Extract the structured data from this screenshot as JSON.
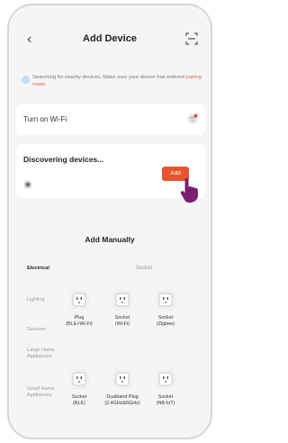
{
  "header": {
    "title": "Add Device",
    "back_icon": "chevron-left-icon",
    "scan_icon": "scan-icon"
  },
  "notice": {
    "text": "Searching for nearby devices. Make sure your device has entered ",
    "link": "pairing mode",
    "suffix": "."
  },
  "wifi": {
    "label": "Turn on Wi-Fi",
    "icon": "wifi-icon"
  },
  "discovering": {
    "label": "Discovering devices...",
    "add_button": "Add",
    "device_icon": "device-icon",
    "accent": "#e8542d"
  },
  "manual": {
    "title": "Add Manually",
    "categories": [
      {
        "label": "Electrical",
        "active": true
      },
      {
        "label": "Lighting",
        "active": false
      },
      {
        "label": "Sensors",
        "active": false
      },
      {
        "label": "Large Home Appliances",
        "active": false
      },
      {
        "label": "Small Home Appliances",
        "active": false
      }
    ],
    "section": "Socket",
    "devices": [
      {
        "label": "Plug\n(BLE+Wi-Fi)"
      },
      {
        "label": "Socket\n(Wi-Fi)"
      },
      {
        "label": "Socket\n(Zigbee)"
      },
      {
        "label": "Socket\n(BLE)"
      },
      {
        "label": "Dualband Plug\n(2.4GHz&5GHz)"
      },
      {
        "label": "Socket\n(NB-IoT)"
      }
    ]
  }
}
